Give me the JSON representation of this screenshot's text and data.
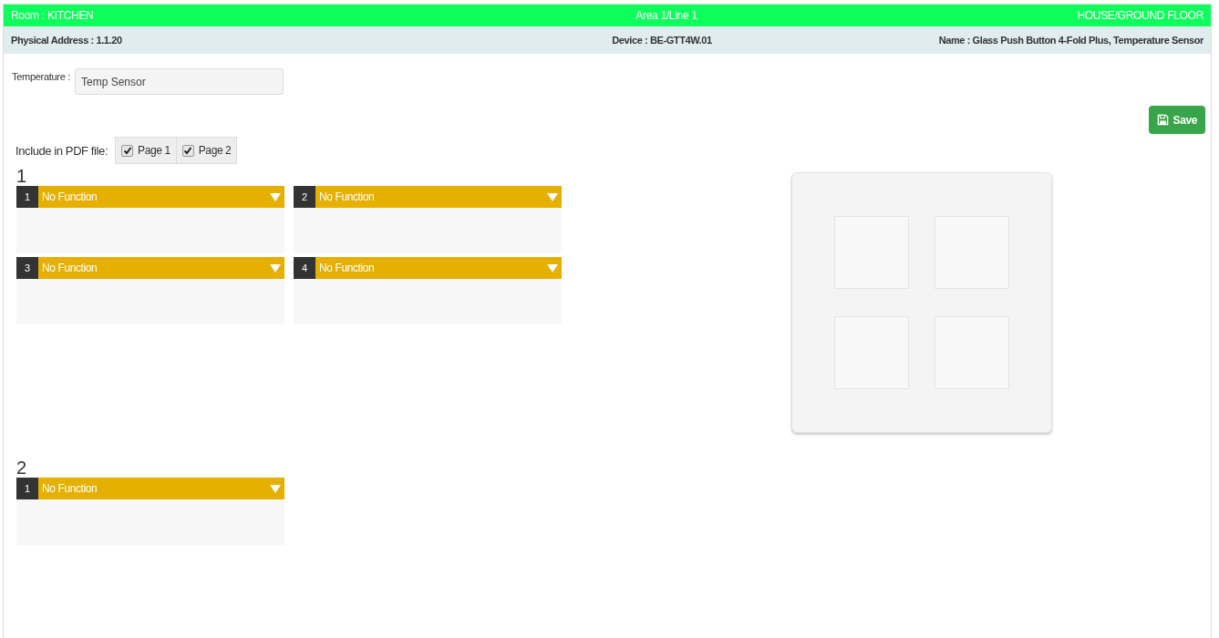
{
  "header": {
    "room": "Room : KITCHEN",
    "line": "Area 1/Line 1",
    "location": "HOUSE/GROUND FLOOR"
  },
  "subheader": {
    "address": "Physical Address : 1.1.20",
    "device": "Device : BE-GTT4W.01",
    "name": "Name : Glass Push Button 4-Fold Plus, Temperature Sensor"
  },
  "temperature": {
    "label": "Temperature :",
    "value": "Temp Sensor"
  },
  "save_button": {
    "label": "Save"
  },
  "pdf": {
    "label": "Include in PDF file:",
    "pages": [
      {
        "label": "Page 1",
        "checked": true
      },
      {
        "label": "Page 2",
        "checked": true
      }
    ]
  },
  "pages": [
    {
      "title": "1",
      "buttons": [
        {
          "number": "1",
          "function": "No Function"
        },
        {
          "number": "2",
          "function": "No Function"
        },
        {
          "number": "3",
          "function": "No Function"
        },
        {
          "number": "4",
          "function": "No Function"
        }
      ]
    },
    {
      "title": "2",
      "buttons": [
        {
          "number": "1",
          "function": "No Function"
        }
      ]
    }
  ]
}
